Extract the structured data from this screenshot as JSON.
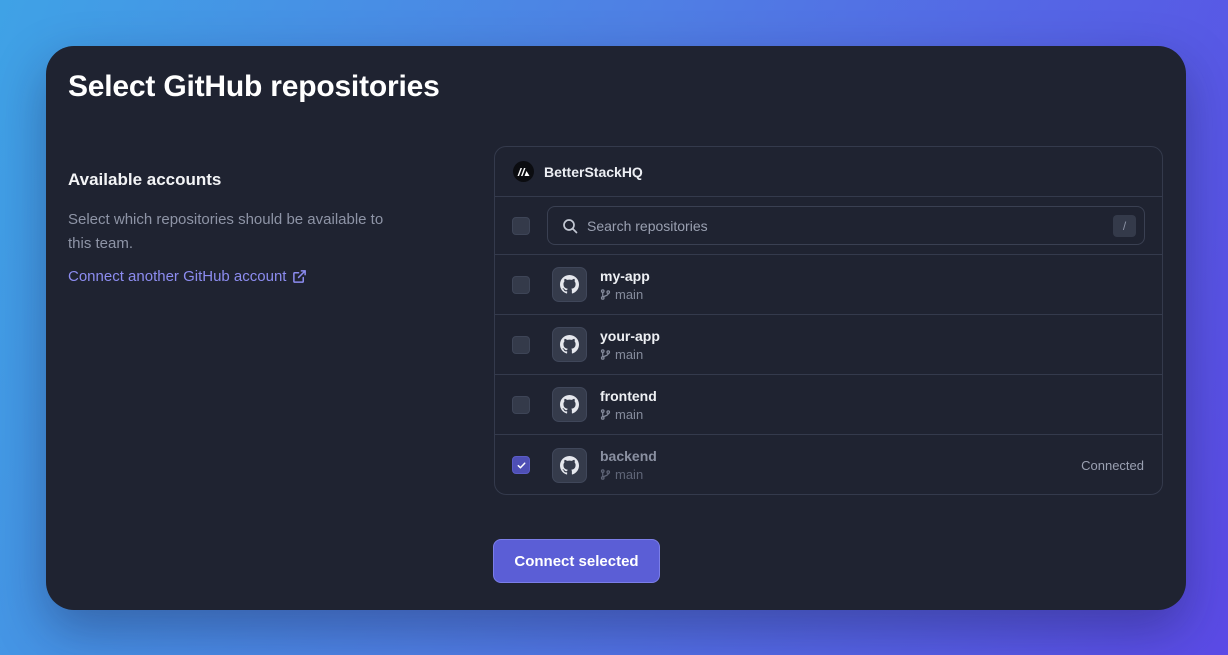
{
  "page": {
    "title": "Select GitHub repositories"
  },
  "accounts_section": {
    "title": "Available accounts",
    "description": "Select which repositories should be available to this team.",
    "connect_link_label": "Connect another GitHub account"
  },
  "repo_panel": {
    "org_name": "BetterStackHQ",
    "search": {
      "placeholder": "Search repositories",
      "value": "",
      "shortcut": "/"
    },
    "repos": [
      {
        "name": "my-app",
        "branch": "main",
        "checked": false,
        "status": ""
      },
      {
        "name": "your-app",
        "branch": "main",
        "checked": false,
        "status": ""
      },
      {
        "name": "frontend",
        "branch": "main",
        "checked": false,
        "status": ""
      },
      {
        "name": "backend",
        "branch": "main",
        "checked": true,
        "status": "Connected"
      }
    ]
  },
  "actions": {
    "connect_selected_label": "Connect selected"
  },
  "colors": {
    "accent": "#5b5ed6",
    "link": "#8c8cf0",
    "card_bg": "#1f2331"
  }
}
